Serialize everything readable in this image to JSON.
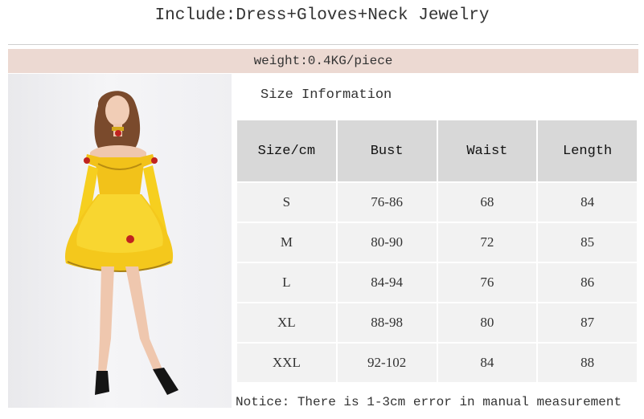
{
  "header": {
    "title": "Include:Dress+Gloves+Neck Jewelry"
  },
  "weight": {
    "text": "weight:0.4KG/piece"
  },
  "size_info": {
    "label": "Size Information"
  },
  "size_table": {
    "headers": [
      "Size/cm",
      "Bust",
      "Waist",
      "Length"
    ],
    "rows": [
      [
        "S",
        "76-86",
        "68",
        "84"
      ],
      [
        "M",
        "80-90",
        "72",
        "85"
      ],
      [
        "L",
        "84-94",
        "76",
        "86"
      ],
      [
        "XL",
        "88-98",
        "80",
        "87"
      ],
      [
        "XXL",
        "92-102",
        "84",
        "88"
      ]
    ]
  },
  "notice": {
    "text": "Notice: There is 1-3cm error in manual measurement"
  },
  "colors": {
    "weight_bar": "#ecd9d2",
    "header_cell": "#d8d8d8",
    "body_cell": "#f2f2f2",
    "dress": "#f6cf1f",
    "rose": "#c0231f"
  }
}
